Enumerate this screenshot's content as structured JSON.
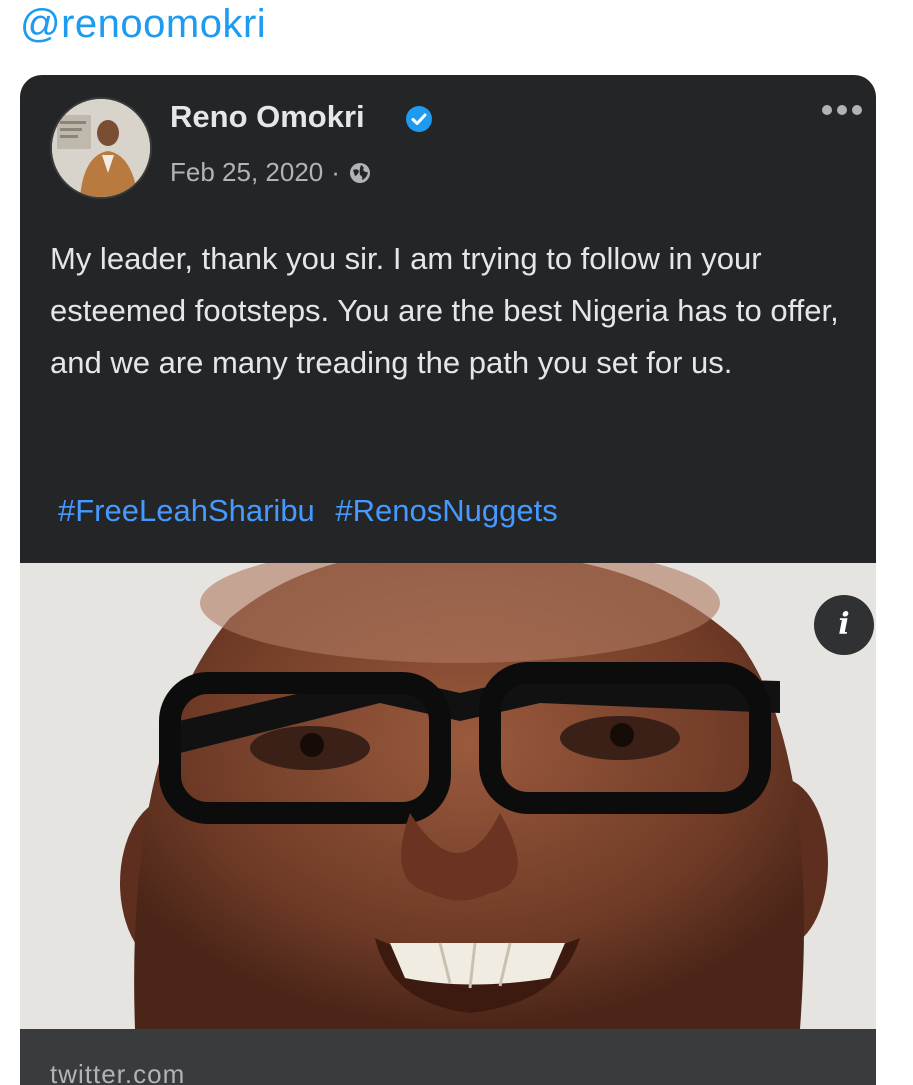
{
  "handle": "@renoomokri",
  "post": {
    "author": "Reno Omokri",
    "date": "Feb 25, 2020",
    "separator": "·",
    "text": "My leader, thank you sir. I am trying to follow in your esteemed footsteps. You are the best Nigeria has to offer, and we are many treading the path you set for us.",
    "hashtags": [
      "#FreeLeahSharibu",
      "#RenosNuggets"
    ],
    "info_label": "i",
    "link_domain": "twitter.com"
  },
  "colors": {
    "card_bg": "#242526",
    "handle": "#1d9bf0",
    "hashtag": "#4599ff",
    "verified": "#1d9bf0"
  },
  "icons": {
    "verified": "verified-badge-icon",
    "privacy": "globe-icon",
    "more": "more-options-icon",
    "info": "info-icon"
  }
}
